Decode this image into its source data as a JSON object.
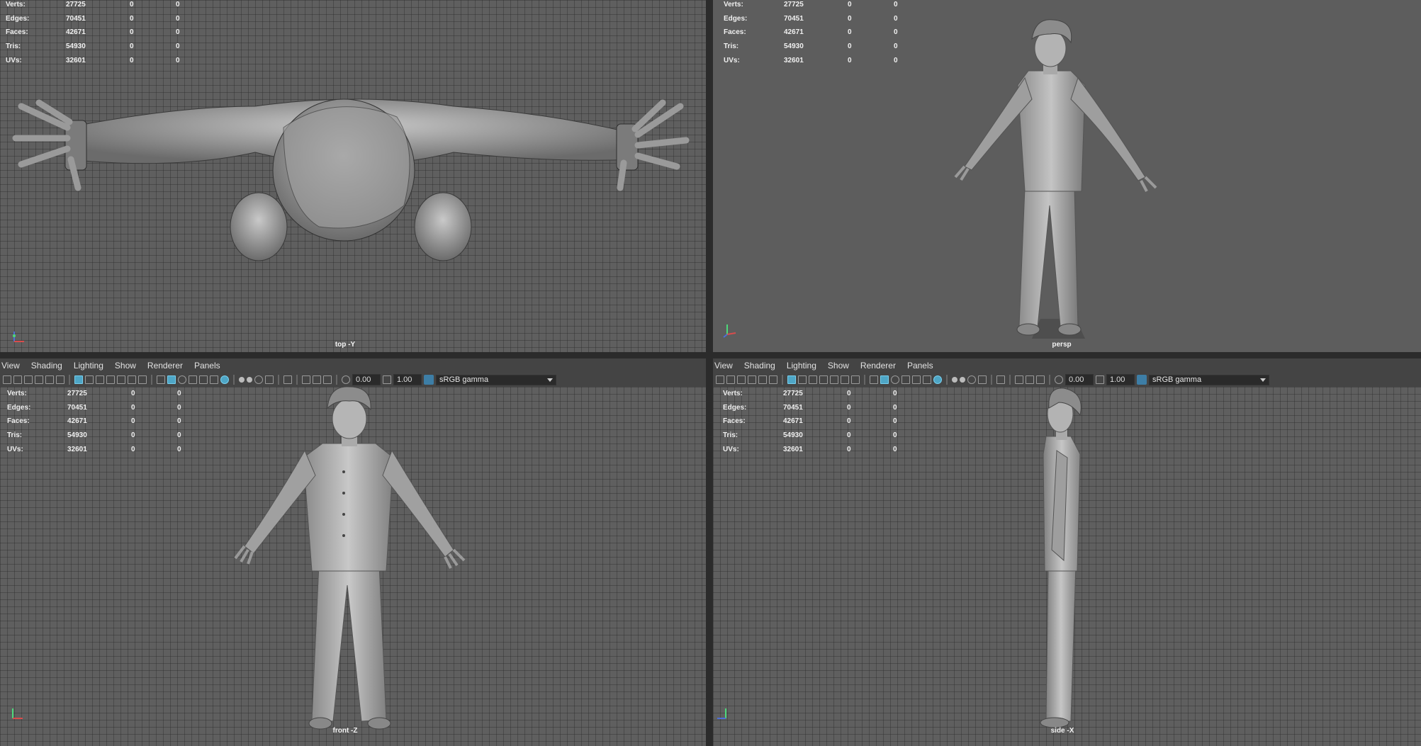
{
  "menu": [
    "View",
    "Shading",
    "Lighting",
    "Show",
    "Renderer",
    "Panels"
  ],
  "toolbar": {
    "exposure": "0.00",
    "gamma": "1.00",
    "color_space": "sRGB gamma"
  },
  "hud": {
    "rows": [
      {
        "label": "Verts:",
        "v1": "27725",
        "v2": "0",
        "v3": "0"
      },
      {
        "label": "Edges:",
        "v1": "70451",
        "v2": "0",
        "v3": "0"
      },
      {
        "label": "Faces:",
        "v1": "42671",
        "v2": "0",
        "v3": "0"
      },
      {
        "label": "Tris:",
        "v1": "54930",
        "v2": "0",
        "v3": "0"
      },
      {
        "label": "UVs:",
        "v1": "32601",
        "v2": "0",
        "v3": "0"
      }
    ]
  },
  "viewports": {
    "top": {
      "camera": "top -Y"
    },
    "persp": {
      "camera": "persp"
    },
    "front": {
      "camera": "front -Z"
    },
    "side": {
      "camera": "side -X"
    }
  },
  "axis_labels": {
    "x": "x",
    "y": "y",
    "z": "z"
  }
}
